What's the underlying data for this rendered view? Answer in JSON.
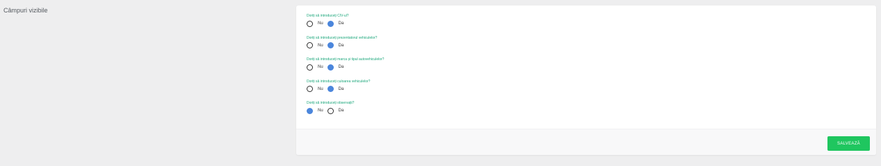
{
  "section": {
    "title": "Câmpuri vizibile"
  },
  "questions": [
    {
      "label": "Doriți să introduceți CIV-ul?",
      "options": [
        "Nu",
        "Da"
      ],
      "selected": "Da"
    },
    {
      "label": "Doriți să introduceți prezentatorul vehiculelor?",
      "options": [
        "Nu",
        "Da"
      ],
      "selected": "Da"
    },
    {
      "label": "Doriți să introduceți marca și tipul autovehiculelor?",
      "options": [
        "Nu",
        "Da"
      ],
      "selected": "Da"
    },
    {
      "label": "Doriți să introduceți culoarea vehiculelor?",
      "options": [
        "Nu",
        "Da"
      ],
      "selected": "Da"
    },
    {
      "label": "Doriți să introduceți observații?",
      "options": [
        "Nu",
        "Da"
      ],
      "selected": "Nu"
    }
  ],
  "footer": {
    "save_label": "SALVEAZĂ"
  },
  "colors": {
    "accent_green": "#1fc65f",
    "label_green": "#1aa67a",
    "radio_selected": "#4b86dc"
  }
}
